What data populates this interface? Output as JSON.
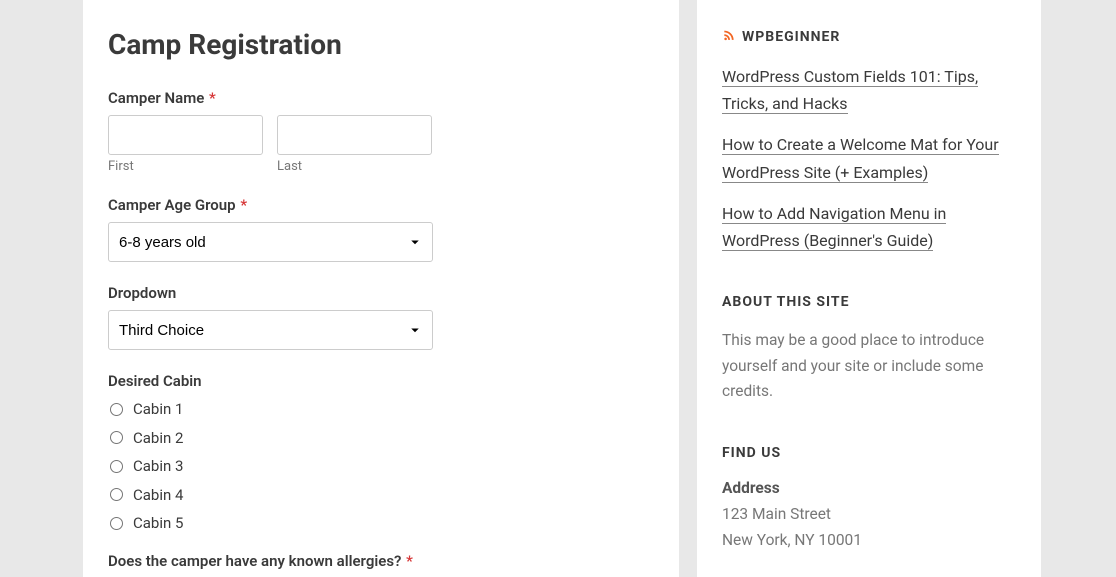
{
  "page": {
    "title": "Camp Registration"
  },
  "form": {
    "camperName": {
      "label": "Camper Name",
      "firstSub": "First",
      "lastSub": "Last"
    },
    "ageGroup": {
      "label": "Camper Age Group",
      "value": "6-8 years old"
    },
    "dropdown": {
      "label": "Dropdown",
      "value": "Third Choice"
    },
    "cabin": {
      "label": "Desired Cabin",
      "options": {
        "o1": "Cabin 1",
        "o2": "Cabin 2",
        "o3": "Cabin 3",
        "o4": "Cabin 4",
        "o5": "Cabin 5"
      }
    },
    "allergies": {
      "label": "Does the camper have any known allergies?"
    }
  },
  "required": "*",
  "sidebar": {
    "rss": {
      "title": "WPBEGINNER",
      "items": {
        "i1": "WordPress Custom Fields 101: Tips, Tricks, and Hacks",
        "i2": "How to Create a Welcome Mat for Your WordPress Site (+ Examples)",
        "i3": "How to Add Navigation Menu in WordPress (Beginner's Guide)"
      }
    },
    "about": {
      "title": "ABOUT THIS SITE",
      "text": "This may be a good place to introduce yourself and your site or include some credits."
    },
    "findUs": {
      "title": "FIND US",
      "addressLabel": "Address",
      "line1": "123 Main Street",
      "line2": "New York, NY 10001"
    }
  }
}
